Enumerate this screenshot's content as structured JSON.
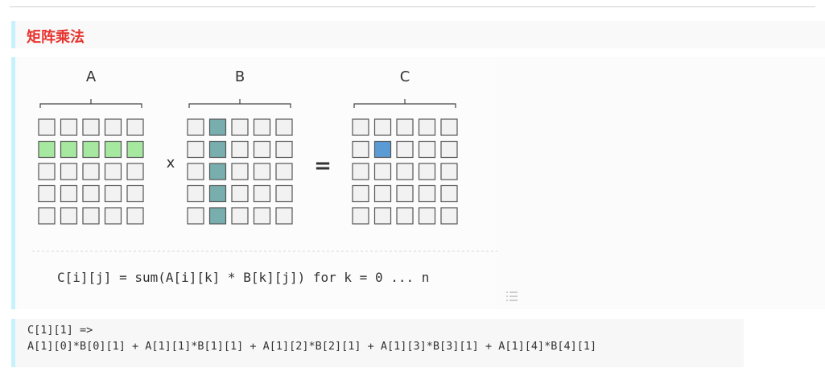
{
  "heading": "矩阵乘法",
  "figure": {
    "matrices": [
      {
        "label": "A",
        "highlight": "row",
        "index": 1,
        "color": "#a7e8a0"
      },
      {
        "label": "B",
        "highlight": "col",
        "index": 1,
        "color": "#78aeae"
      },
      {
        "label": "C",
        "highlight": "cell",
        "index": [
          1,
          1
        ],
        "color": "#5b9bd5"
      }
    ],
    "operator_times": "x",
    "operator_equals": "=",
    "grid_size": 5,
    "formula": "C[i][j] = sum(A[i][k] * B[k][j]) for k = 0 ... n"
  },
  "code": {
    "line1": "C[1][1] =>",
    "line2": "A[1][0]*B[0][1] + A[1][1]*B[1][1] + A[1][2]*B[2][1] + A[1][3]*B[3][1] + A[1][4]*B[4][1]"
  },
  "icons": {
    "list": "list-icon"
  }
}
